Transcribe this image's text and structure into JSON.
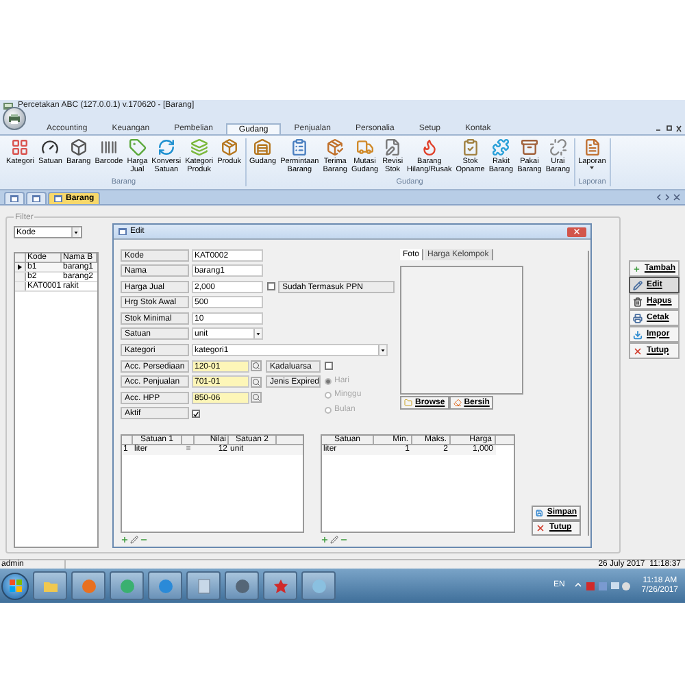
{
  "window": {
    "title": "Percetakan ABC (127.0.0.1) v.170620 - [Barang]"
  },
  "ribbon": {
    "tabs": [
      {
        "label": "Accounting",
        "selected": false
      },
      {
        "label": "Keuangan",
        "selected": false
      },
      {
        "label": "Pembelian",
        "selected": false
      },
      {
        "label": "Gudang",
        "selected": true
      },
      {
        "label": "Penjualan",
        "selected": false
      },
      {
        "label": "Personalia",
        "selected": false
      },
      {
        "label": "Setup",
        "selected": false
      },
      {
        "label": "Kontak",
        "selected": false
      }
    ],
    "groups": [
      {
        "caption": "Barang",
        "buttons": [
          "Kategori",
          "Satuan",
          "Barang",
          "Barcode",
          "Harga Jual",
          "Konversi Satuan",
          "Kategori Produk",
          "Produk"
        ]
      },
      {
        "caption": "Gudang",
        "buttons": [
          "Gudang",
          "Permintaan Barang",
          "Terima Barang",
          "Mutasi Gudang",
          "Revisi Stok",
          "Barang Hilang/Rusak",
          "Stok Opname",
          "Rakit Barang",
          "Pakai Barang",
          "Urai Barang"
        ]
      },
      {
        "caption": "Laporan",
        "buttons": [
          "Laporan"
        ]
      }
    ]
  },
  "doc_tabs": [
    {
      "kind": "icon",
      "selected": false
    },
    {
      "kind": "icon",
      "selected": false
    },
    {
      "kind": "text",
      "label": "Barang",
      "selected": true
    }
  ],
  "filter": {
    "title": "Filter",
    "field": "Kode"
  },
  "grid": {
    "columns": [
      "Kode",
      "Nama B"
    ],
    "rows": [
      {
        "cells": [
          "b1",
          "barang1"
        ],
        "selected": true
      },
      {
        "cells": [
          "b2",
          "barang2"
        ],
        "selected": false
      },
      {
        "cells": [
          "KAT0001",
          "rakit"
        ],
        "selected": false
      }
    ]
  },
  "side_buttons": [
    {
      "label": "Tambah",
      "selected": false
    },
    {
      "label": "Edit",
      "selected": true
    },
    {
      "label": "Hapus",
      "selected": false
    },
    {
      "label": "Cetak",
      "selected": false
    },
    {
      "label": "Impor",
      "selected": false
    },
    {
      "label": "Tutup",
      "selected": false
    }
  ],
  "dialog": {
    "title": "Edit",
    "fields": [
      {
        "kind": "text",
        "label": "Kode",
        "value": "KAT0002"
      },
      {
        "kind": "text",
        "label": "Nama",
        "value": "barang1"
      },
      {
        "kind": "text",
        "label": "Harga Jual",
        "value": "2,000",
        "extra": {
          "kind": "check",
          "label": "Sudah Termasuk PPN",
          "checked": false
        }
      },
      {
        "kind": "text",
        "label": "Hrg Stok Awal",
        "value": "500"
      },
      {
        "kind": "text",
        "label": "Stok Minimal",
        "value": "10"
      },
      {
        "kind": "combo",
        "label": "Satuan",
        "value": "unit"
      },
      {
        "kind": "combo_wide",
        "label": "Kategori",
        "value": "kategori1"
      },
      {
        "kind": "lookup",
        "label": "Acc. Persediaan",
        "value": "120-01",
        "extra": {
          "kind": "label_check",
          "label": "Kadaluarsa",
          "checked": false
        }
      },
      {
        "kind": "lookup",
        "label": "Acc. Penjualan",
        "value": "701-01",
        "extra": {
          "kind": "radio_group",
          "label": "Jenis Expired",
          "disabled": true,
          "options": [
            {
              "label": "Hari",
              "selected": true
            },
            {
              "label": "Minggu",
              "selected": false
            },
            {
              "label": "Bulan",
              "selected": false
            }
          ]
        }
      },
      {
        "kind": "lookup",
        "label": "Acc. HPP",
        "value": "850-06"
      },
      {
        "kind": "check",
        "label": "Aktif",
        "checked": true
      }
    ],
    "photo_tabs": [
      {
        "label": "Foto",
        "selected": true
      },
      {
        "label": "Harga Kelompok",
        "selected": false
      }
    ],
    "photo_buttons": [
      "Browse",
      "Bersih"
    ],
    "conversion_grid": {
      "columns": [
        "Satuan 1",
        "Nilai",
        "Satuan 2"
      ],
      "rows": [
        {
          "no": "1",
          "unit_from": "liter",
          "op": "=",
          "value": "12",
          "unit_to": "unit"
        }
      ]
    },
    "price_grid": {
      "columns": [
        "Satuan",
        "Min.",
        "Maks.",
        "Harga"
      ],
      "rows": [
        {
          "cells": [
            "liter",
            "1",
            "2",
            "1,000"
          ]
        }
      ]
    },
    "buttons": [
      "Simpan",
      "Tutup"
    ]
  },
  "status_bar": {
    "user": "admin",
    "datetime": "26 July 2017  11:18:37"
  },
  "taskbar": {
    "language": "EN",
    "time": "11:18 AM",
    "date": "7/26/2017"
  }
}
